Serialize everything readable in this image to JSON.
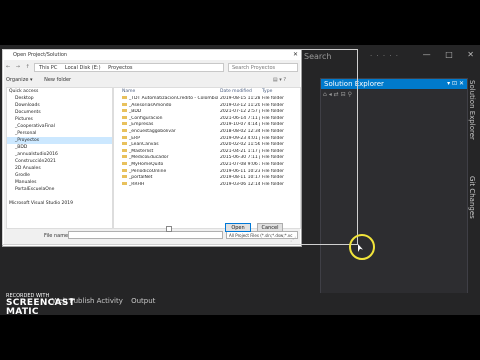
{
  "ide": {
    "search_label": "Search",
    "window_buttons": [
      "—",
      "□",
      "✕"
    ]
  },
  "solution_explorer": {
    "title": "Solution Explorer",
    "title_buttons": "▾ ⊡ ✕"
  },
  "side_tabs": [
    "Solution Explorer",
    "Git Changes"
  ],
  "bottom_tabs": [
    "Web Publish Activity",
    "Output"
  ],
  "watermark": {
    "line1": "RECORDED WITH",
    "line2": "SCREENCAST",
    "line3": "MATIC"
  },
  "dialog": {
    "title": "Open Project/Solution",
    "breadcrumbs": [
      "This PC",
      "Local Disk (E:)",
      "Proyectos"
    ],
    "search_placeholder": "Search Proyectos",
    "organize": "Organize ▾",
    "new_folder": "New folder",
    "nav_items": [
      "Quick access",
      "Desktop",
      "Downloads",
      "Documents",
      "Pictures",
      "_CooperativaFinal",
      "_Personal",
      "_Proyectos",
      "_BDD",
      "_annualstudio2016",
      "Construcción2021",
      "2D Anuales",
      "Grodle",
      "Manuales",
      "PortalEscuelaOne",
      "",
      "Microsoft Visual Studio 2019"
    ],
    "columns": [
      "Name",
      "Date modified",
      "Type"
    ],
    "files": [
      {
        "name": "_TDT AutomatizacionCredito - Colombia",
        "date": "2019-08-15 11:28 ...",
        "type": "File folder"
      },
      {
        "name": "_AsesoriasAmondo",
        "date": "2019-03-12 11:20 ...",
        "type": "File folder"
      },
      {
        "name": "_BDD",
        "date": "2021-07-12 2:57 p.m.",
        "type": "File folder"
      },
      {
        "name": "_Configuracion",
        "date": "2021-06-14 7:11 p.m.",
        "type": "File folder"
      },
      {
        "name": "_Empresas",
        "date": "2019-10-07 4:14 p.m.",
        "type": "File folder"
      },
      {
        "name": "_encuestaggobolivar",
        "date": "2018-08-02 12:34 ...",
        "type": "File folder"
      },
      {
        "name": "_ERP",
        "date": "2019-09-23 4:01 p.m.",
        "type": "File folder"
      },
      {
        "name": "_LeanCanvas",
        "date": "2020-02-02 11:56 ...",
        "type": "File folder"
      },
      {
        "name": "_Masterlist",
        "date": "2021-04-21 1:17 p.m.",
        "type": "File folder"
      },
      {
        "name": "_MedicoEducador",
        "date": "2015-06-30 7:11 p.m.",
        "type": "File folder"
      },
      {
        "name": "_MyHomeQuito",
        "date": "2021-07-08 9:06 a.m.",
        "type": "File folder"
      },
      {
        "name": "_PeriodicoOnline",
        "date": "2019-06-11 10:23 ...",
        "type": "File folder"
      },
      {
        "name": "_portalNet",
        "date": "2019-08-11 10:17 ...",
        "type": "File folder"
      },
      {
        "name": "_RRHH",
        "date": "2019-03-06 12:14 ...",
        "type": "File folder"
      }
    ],
    "file_name_label": "File name:",
    "file_name_value": "",
    "filter": "All Project Files (*.sln;*.dsw;*.vc",
    "open_label": "Open",
    "cancel_label": "Cancel"
  },
  "colors": {
    "accent": "#007acc",
    "selection": "#cce8ff",
    "cursor_ring": "#f2e53b"
  }
}
